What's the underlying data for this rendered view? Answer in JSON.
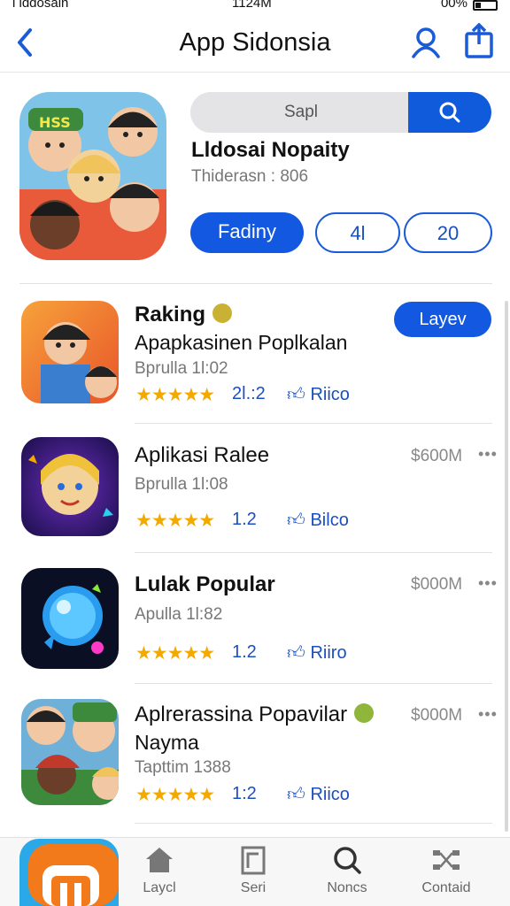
{
  "status_bar": {
    "carrier": "l lddosain",
    "time": "1124M",
    "battery": "00%"
  },
  "nav": {
    "title": "App Sidonsia"
  },
  "search": {
    "placeholder": "Sapl"
  },
  "featured": {
    "name": "Lldosai Nopaity",
    "subtitle": "Thiderasn : 806",
    "primary_button": "Fadiny",
    "button_2": "4l",
    "button_3": "20"
  },
  "apps": [
    {
      "name": "Raking",
      "subtitle": "Apapkasinen Poplkalan",
      "date": "Bprulla 1l:02",
      "rating": 4.5,
      "stars": "★★★★★",
      "rating_label": "2l.:2",
      "likes": "Riico",
      "action": "Layev"
    },
    {
      "name": "Aplikasi Ralee",
      "date": "Bprulla 1l:08",
      "rating": 5,
      "stars": "★★★★★",
      "rating_label": "1.2",
      "likes": "Bilco",
      "price": "$600M",
      "more": "•••"
    },
    {
      "name": "Lulak Popular",
      "date": "Apulla 1l:82",
      "rating": 5,
      "stars": "★★★★★",
      "rating_label": "1.2",
      "likes": "Riiro",
      "price": "$000M",
      "more": "•••"
    },
    {
      "name": "Aplrerassina Popavilar",
      "name_line2": "Nayma",
      "date": "Tapttim 1388",
      "rating": 5,
      "stars": "★★★★★",
      "rating_label": "1:2",
      "likes": "Riico",
      "price": "$000M",
      "more": "•••"
    }
  ],
  "tabs": [
    {
      "label": "Laycl",
      "icon": "home-icon"
    },
    {
      "label": "Seri",
      "icon": "document-icon"
    },
    {
      "label": "Noncs",
      "icon": "search-icon"
    },
    {
      "label": "Contaid",
      "icon": "network-icon"
    }
  ],
  "colors": {
    "accent": "#1258e0",
    "star": "#f2a900",
    "link": "#1a4fc0"
  }
}
